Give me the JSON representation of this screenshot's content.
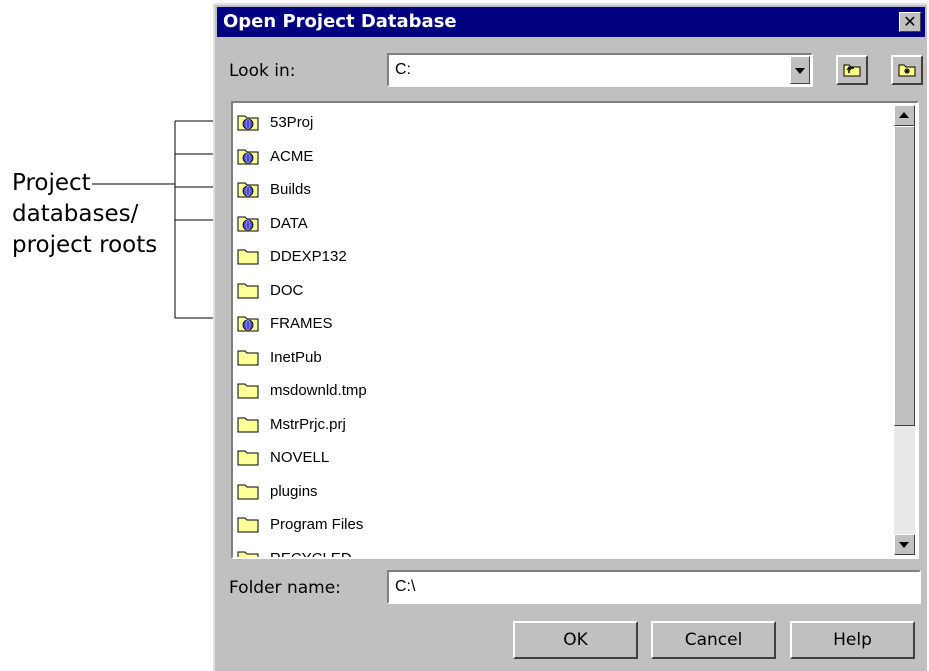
{
  "annotation": {
    "lines": [
      "Project",
      "databases/",
      "project roots"
    ]
  },
  "dialog": {
    "title": "Open Project Database",
    "close_glyph": "✕",
    "look_in_label": "Look in:",
    "look_in_value": "C:",
    "folder_name_label": "Folder name:",
    "folder_name_value": "C:\\",
    "buttons": {
      "ok": "OK",
      "cancel": "Cancel",
      "help": "Help"
    }
  },
  "files": [
    {
      "name": "53Proj",
      "type": "project"
    },
    {
      "name": "ACME",
      "type": "project"
    },
    {
      "name": "Builds",
      "type": "project"
    },
    {
      "name": "DATA",
      "type": "project"
    },
    {
      "name": "DDEXP132",
      "type": "folder"
    },
    {
      "name": "DOC",
      "type": "folder"
    },
    {
      "name": "FRAMES",
      "type": "project"
    },
    {
      "name": "InetPub",
      "type": "folder"
    },
    {
      "name": "msdownld.tmp",
      "type": "folder"
    },
    {
      "name": "MstrPrjc.prj",
      "type": "folder"
    },
    {
      "name": "NOVELL",
      "type": "folder"
    },
    {
      "name": "plugins",
      "type": "folder"
    },
    {
      "name": "Program Files",
      "type": "folder"
    },
    {
      "name": "RECYCLED",
      "type": "folder"
    }
  ],
  "colors": {
    "titlebar": "#000080",
    "dialog_bg": "#c0c0c0",
    "folder_fill": "#ffff99",
    "project_globe": "#4a4ad0"
  },
  "icons": {
    "folder": "folder-icon",
    "project": "project-database-icon",
    "up_one_level": "up-one-level-icon",
    "new_folder": "new-folder-icon"
  }
}
